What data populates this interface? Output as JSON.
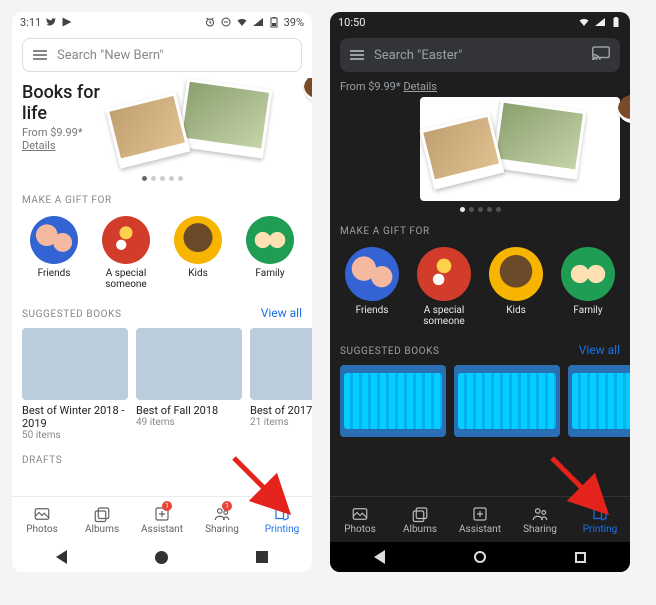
{
  "light": {
    "status": {
      "time": "3:11",
      "battery": "39%"
    },
    "search": {
      "placeholder": "Search \"New Bern\""
    },
    "hero": {
      "title": "Books for life",
      "price": "From $9.99*",
      "details": "Details"
    },
    "gift_label": "MAKE A GIFT FOR",
    "gifts": [
      "Friends",
      "A special someone",
      "Kids",
      "Family"
    ],
    "suggested_label": "SUGGESTED BOOKS",
    "view_all": "View all",
    "books": [
      {
        "title": "Best of Winter 2018 - 2019",
        "items": "50 items"
      },
      {
        "title": "Best of Fall 2018",
        "items": "49 items"
      },
      {
        "title": "Best of 2017",
        "items": "21 items"
      }
    ],
    "drafts_label": "DRAFTS",
    "nav": {
      "photos": "Photos",
      "albums": "Albums",
      "assistant": "Assistant",
      "assistant_badge": "1",
      "sharing": "Sharing",
      "sharing_badge": "1",
      "printing": "Printing"
    }
  },
  "dark": {
    "status": {
      "time": "10:50"
    },
    "search": {
      "placeholder": "Search \"Easter\""
    },
    "hero": {
      "price": "From $9.99*",
      "details": "Details"
    },
    "gift_label": "MAKE A GIFT FOR",
    "gifts": [
      "Friends",
      "A special someone",
      "Kids",
      "Family"
    ],
    "suggested_label": "SUGGESTED BOOKS",
    "view_all": "View all",
    "nav": {
      "photos": "Photos",
      "albums": "Albums",
      "assistant": "Assistant",
      "sharing": "Sharing",
      "printing": "Printing"
    }
  }
}
